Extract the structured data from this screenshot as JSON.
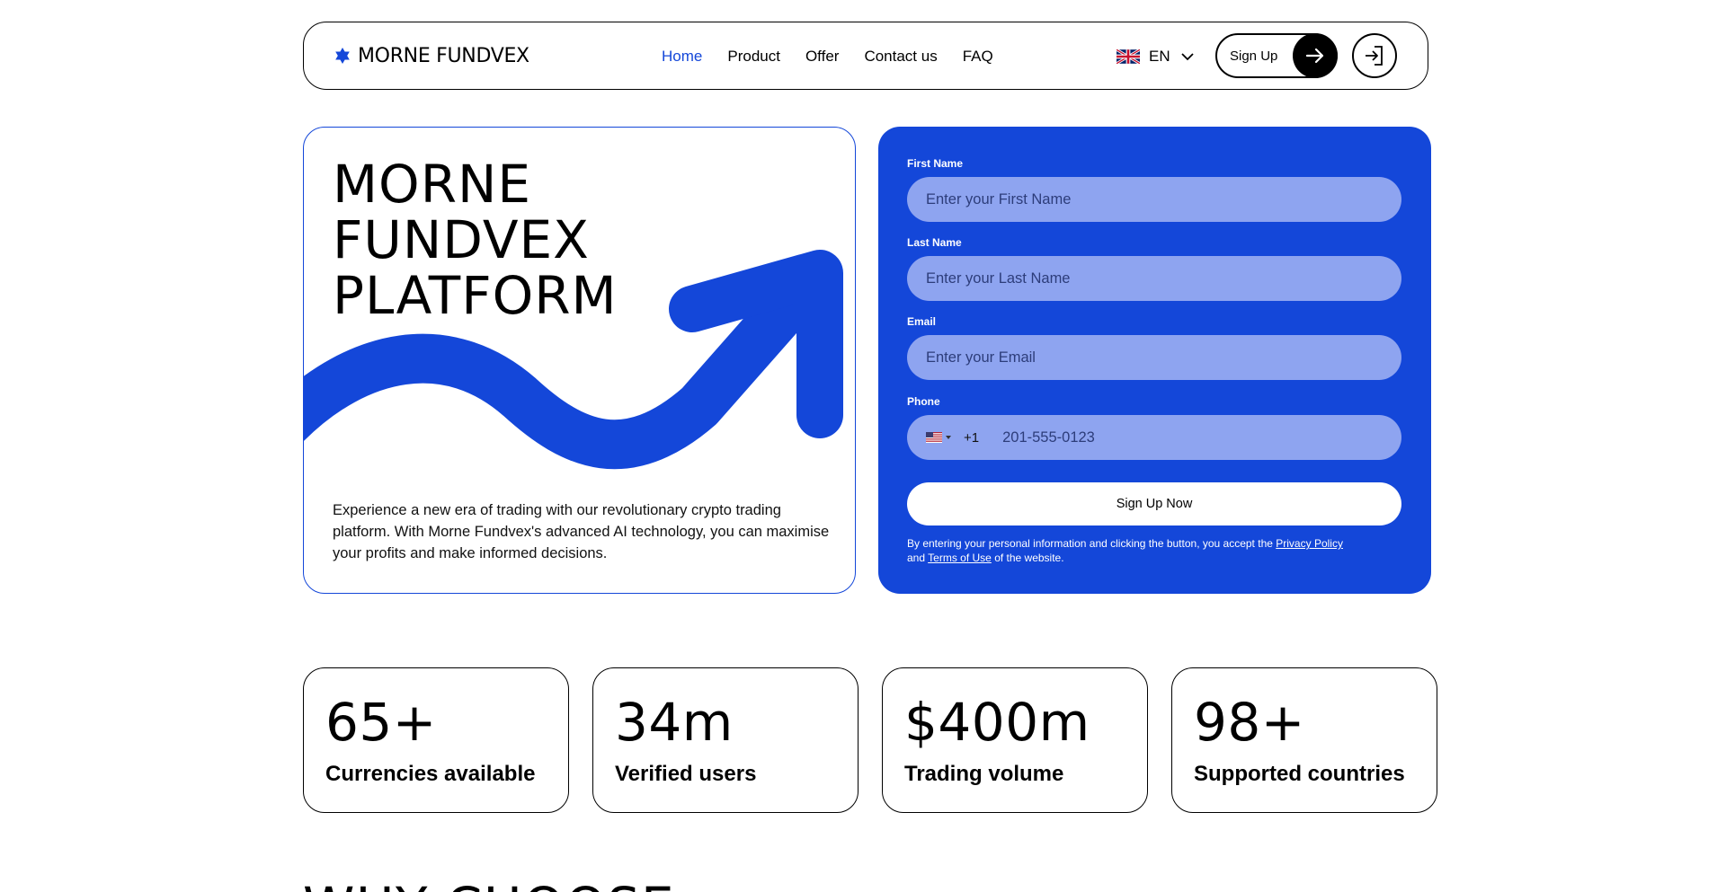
{
  "brand": {
    "name": "MORNE FUNDVEX",
    "accent_color": "#1447d9"
  },
  "nav": {
    "items": [
      {
        "label": "Home",
        "active": true
      },
      {
        "label": "Product",
        "active": false
      },
      {
        "label": "Offer",
        "active": false
      },
      {
        "label": "Contact us",
        "active": false
      },
      {
        "label": "FAQ",
        "active": false
      }
    ],
    "language": {
      "flag": "uk-flag-icon",
      "code": "EN"
    },
    "signup_label": "Sign Up"
  },
  "hero": {
    "title_lines": [
      "MORNE",
      "FUNDVEX",
      "PLATFORM"
    ],
    "description": "Experience a new era of trading with our revolutionary crypto trading platform. With Morne Fundvex's advanced AI technology, you can maximise your profits and make informed decisions."
  },
  "form": {
    "first_name": {
      "label": "First Name",
      "placeholder": "Enter your First Name",
      "value": ""
    },
    "last_name": {
      "label": "Last Name",
      "placeholder": "Enter your Last Name",
      "value": ""
    },
    "email": {
      "label": "Email",
      "placeholder": "Enter your Email",
      "value": ""
    },
    "phone": {
      "label": "Phone",
      "country_flag": "us-flag-icon",
      "dial_code": "+1",
      "placeholder": "201-555-0123",
      "value": ""
    },
    "submit_label": "Sign Up Now",
    "legal": {
      "prefix": "By entering your personal information and clicking the button, you accept the",
      "privacy_link": "Privacy Policy",
      "middle": "and",
      "terms_link": "Terms of Use",
      "suffix": "of the website."
    }
  },
  "stats": [
    {
      "value": "65+",
      "label": "Currencies available"
    },
    {
      "value": "34m",
      "label": "Verified users"
    },
    {
      "value": "$400m",
      "label": "Trading volume"
    },
    {
      "value": "98+",
      "label": "Supported countries"
    }
  ],
  "next_section": {
    "title_peek": "WHY CHOOSE"
  }
}
